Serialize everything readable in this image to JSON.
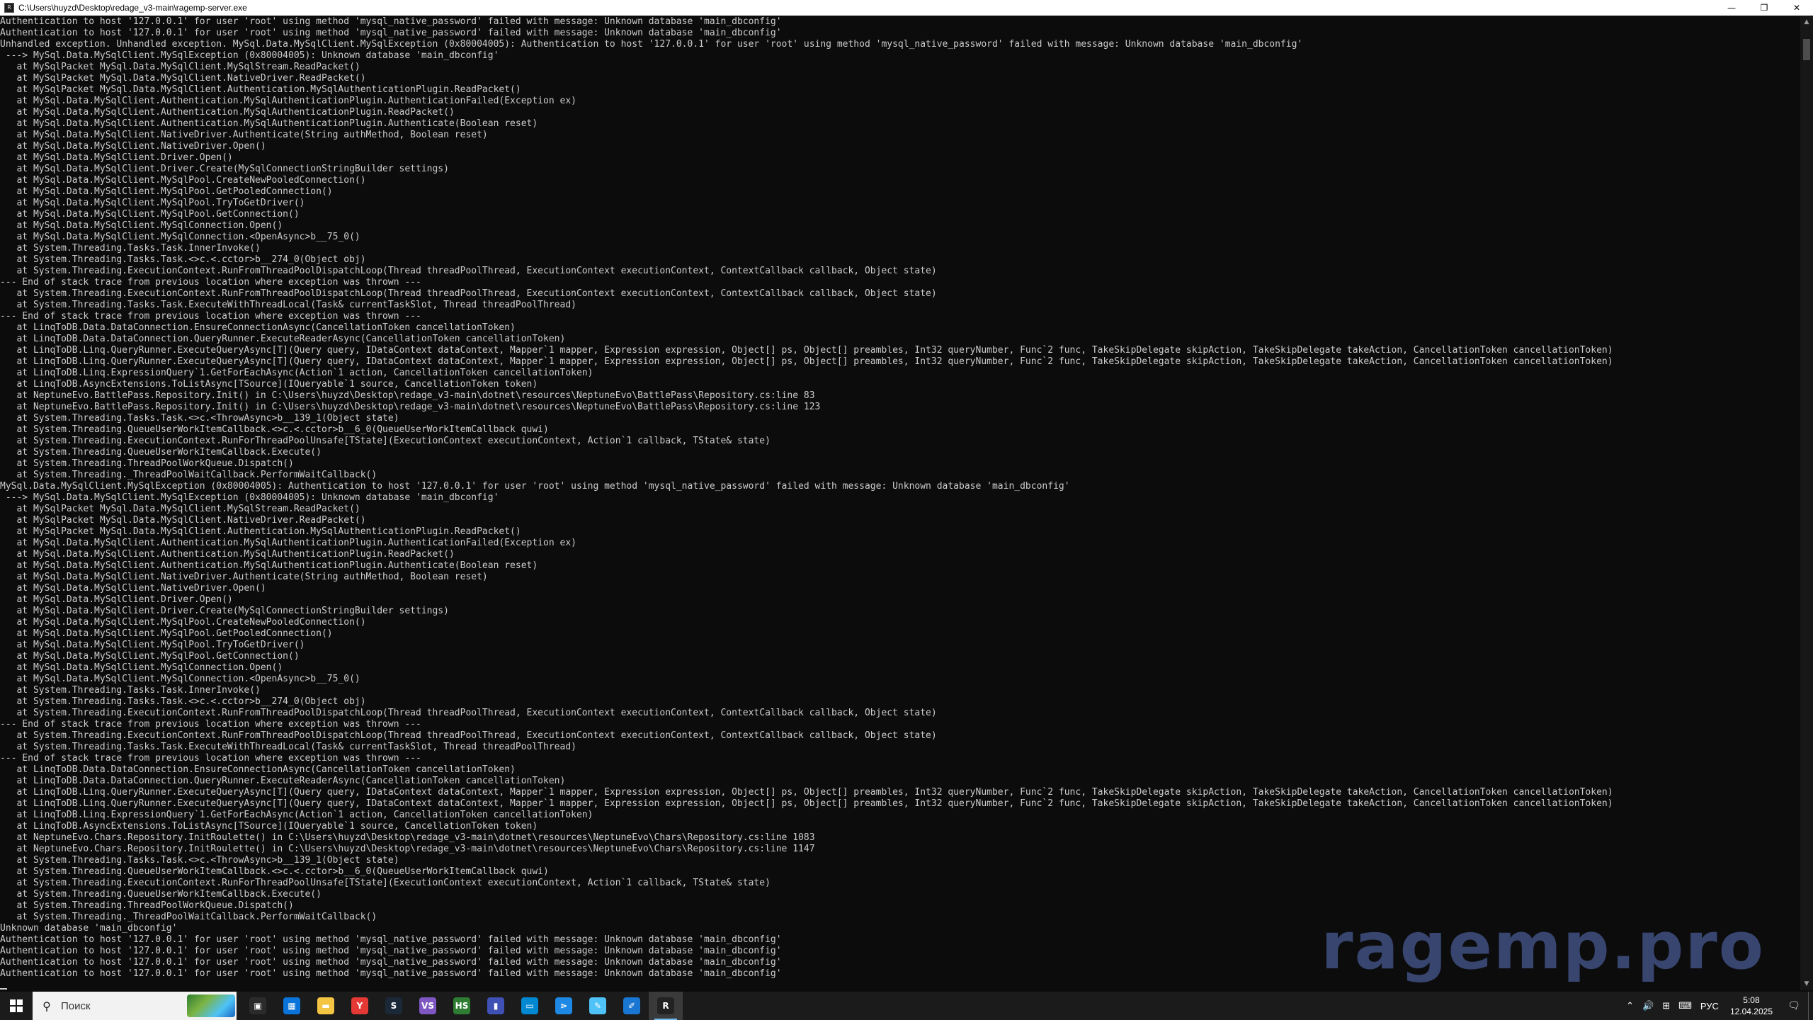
{
  "window": {
    "title": "C:\\Users\\huyzd\\Desktop\\redage_v3-main\\ragemp-server.exe",
    "icon_glyph": "R",
    "minimize_glyph": "—",
    "maximize_glyph": "❐",
    "close_glyph": "✕"
  },
  "console": {
    "lines": [
      "Authentication to host '127.0.0.1' for user 'root' using method 'mysql_native_password' failed with message: Unknown database 'main_dbconfig'",
      "Authentication to host '127.0.0.1' for user 'root' using method 'mysql_native_password' failed with message: Unknown database 'main_dbconfig'",
      "Unhandled exception. Unhandled exception. MySql.Data.MySqlClient.MySqlException (0x80004005): Authentication to host '127.0.0.1' for user 'root' using method 'mysql_native_password' failed with message: Unknown database 'main_dbconfig'",
      " ---> MySql.Data.MySqlClient.MySqlException (0x80004005): Unknown database 'main_dbconfig'",
      "   at MySqlPacket MySql.Data.MySqlClient.MySqlStream.ReadPacket()",
      "   at MySqlPacket MySql.Data.MySqlClient.NativeDriver.ReadPacket()",
      "   at MySqlPacket MySql.Data.MySqlClient.Authentication.MySqlAuthenticationPlugin.ReadPacket()",
      "   at MySql.Data.MySqlClient.Authentication.MySqlAuthenticationPlugin.AuthenticationFailed(Exception ex)",
      "   at MySql.Data.MySqlClient.Authentication.MySqlAuthenticationPlugin.ReadPacket()",
      "   at MySql.Data.MySqlClient.Authentication.MySqlAuthenticationPlugin.Authenticate(Boolean reset)",
      "   at MySql.Data.MySqlClient.NativeDriver.Authenticate(String authMethod, Boolean reset)",
      "   at MySql.Data.MySqlClient.NativeDriver.Open()",
      "   at MySql.Data.MySqlClient.Driver.Open()",
      "   at MySql.Data.MySqlClient.Driver.Create(MySqlConnectionStringBuilder settings)",
      "   at MySql.Data.MySqlClient.MySqlPool.CreateNewPooledConnection()",
      "   at MySql.Data.MySqlClient.MySqlPool.GetPooledConnection()",
      "   at MySql.Data.MySqlClient.MySqlPool.TryToGetDriver()",
      "   at MySql.Data.MySqlClient.MySqlPool.GetConnection()",
      "   at MySql.Data.MySqlClient.MySqlConnection.Open()",
      "   at MySql.Data.MySqlClient.MySqlConnection.<OpenAsync>b__75_0()",
      "   at System.Threading.Tasks.Task.InnerInvoke()",
      "   at System.Threading.Tasks.Task.<>c.<.cctor>b__274_0(Object obj)",
      "   at System.Threading.ExecutionContext.RunFromThreadPoolDispatchLoop(Thread threadPoolThread, ExecutionContext executionContext, ContextCallback callback, Object state)",
      "--- End of stack trace from previous location where exception was thrown ---",
      "   at System.Threading.ExecutionContext.RunFromThreadPoolDispatchLoop(Thread threadPoolThread, ExecutionContext executionContext, ContextCallback callback, Object state)",
      "   at System.Threading.Tasks.Task.ExecuteWithThreadLocal(Task& currentTaskSlot, Thread threadPoolThread)",
      "--- End of stack trace from previous location where exception was thrown ---",
      "   at LinqToDB.Data.DataConnection.EnsureConnectionAsync(CancellationToken cancellationToken)",
      "   at LinqToDB.Data.DataConnection.QueryRunner.ExecuteReaderAsync(CancellationToken cancellationToken)",
      "   at LinqToDB.Linq.QueryRunner.ExecuteQueryAsync[T](Query query, IDataContext dataContext, Mapper`1 mapper, Expression expression, Object[] ps, Object[] preambles, Int32 queryNumber, Func`2 func, TakeSkipDelegate skipAction, TakeSkipDelegate takeAction, CancellationToken cancellationToken)",
      "   at LinqToDB.Linq.QueryRunner.ExecuteQueryAsync[T](Query query, IDataContext dataContext, Mapper`1 mapper, Expression expression, Object[] ps, Object[] preambles, Int32 queryNumber, Func`2 func, TakeSkipDelegate skipAction, TakeSkipDelegate takeAction, CancellationToken cancellationToken)",
      "   at LinqToDB.Linq.ExpressionQuery`1.GetForEachAsync(Action`1 action, CancellationToken cancellationToken)",
      "   at LinqToDB.AsyncExtensions.ToListAsync[TSource](IQueryable`1 source, CancellationToken token)",
      "   at NeptuneEvo.BattlePass.Repository.Init() in C:\\Users\\huyzd\\Desktop\\redage_v3-main\\dotnet\\resources\\NeptuneEvo\\BattlePass\\Repository.cs:line 83",
      "   at NeptuneEvo.BattlePass.Repository.Init() in C:\\Users\\huyzd\\Desktop\\redage_v3-main\\dotnet\\resources\\NeptuneEvo\\BattlePass\\Repository.cs:line 123",
      "   at System.Threading.Tasks.Task.<>c.<ThrowAsync>b__139_1(Object state)",
      "   at System.Threading.QueueUserWorkItemCallback.<>c.<.cctor>b__6_0(QueueUserWorkItemCallback quwi)",
      "   at System.Threading.ExecutionContext.RunForThreadPoolUnsafe[TState](ExecutionContext executionContext, Action`1 callback, TState& state)",
      "   at System.Threading.QueueUserWorkItemCallback.Execute()",
      "   at System.Threading.ThreadPoolWorkQueue.Dispatch()",
      "   at System.Threading._ThreadPoolWaitCallback.PerformWaitCallback()",
      "MySql.Data.MySqlClient.MySqlException (0x80004005): Authentication to host '127.0.0.1' for user 'root' using method 'mysql_native_password' failed with message: Unknown database 'main_dbconfig'",
      " ---> MySql.Data.MySqlClient.MySqlException (0x80004005): Unknown database 'main_dbconfig'",
      "   at MySqlPacket MySql.Data.MySqlClient.MySqlStream.ReadPacket()",
      "   at MySqlPacket MySql.Data.MySqlClient.NativeDriver.ReadPacket()",
      "   at MySqlPacket MySql.Data.MySqlClient.Authentication.MySqlAuthenticationPlugin.ReadPacket()",
      "   at MySql.Data.MySqlClient.Authentication.MySqlAuthenticationPlugin.AuthenticationFailed(Exception ex)",
      "   at MySql.Data.MySqlClient.Authentication.MySqlAuthenticationPlugin.ReadPacket()",
      "   at MySql.Data.MySqlClient.Authentication.MySqlAuthenticationPlugin.Authenticate(Boolean reset)",
      "   at MySql.Data.MySqlClient.NativeDriver.Authenticate(String authMethod, Boolean reset)",
      "   at MySql.Data.MySqlClient.NativeDriver.Open()",
      "   at MySql.Data.MySqlClient.Driver.Open()",
      "   at MySql.Data.MySqlClient.Driver.Create(MySqlConnectionStringBuilder settings)",
      "   at MySql.Data.MySqlClient.MySqlPool.CreateNewPooledConnection()",
      "   at MySql.Data.MySqlClient.MySqlPool.GetPooledConnection()",
      "   at MySql.Data.MySqlClient.MySqlPool.TryToGetDriver()",
      "   at MySql.Data.MySqlClient.MySqlPool.GetConnection()",
      "   at MySql.Data.MySqlClient.MySqlConnection.Open()",
      "   at MySql.Data.MySqlClient.MySqlConnection.<OpenAsync>b__75_0()",
      "   at System.Threading.Tasks.Task.InnerInvoke()",
      "   at System.Threading.Tasks.Task.<>c.<.cctor>b__274_0(Object obj)",
      "   at System.Threading.ExecutionContext.RunFromThreadPoolDispatchLoop(Thread threadPoolThread, ExecutionContext executionContext, ContextCallback callback, Object state)",
      "--- End of stack trace from previous location where exception was thrown ---",
      "   at System.Threading.ExecutionContext.RunFromThreadPoolDispatchLoop(Thread threadPoolThread, ExecutionContext executionContext, ContextCallback callback, Object state)",
      "   at System.Threading.Tasks.Task.ExecuteWithThreadLocal(Task& currentTaskSlot, Thread threadPoolThread)",
      "--- End of stack trace from previous location where exception was thrown ---",
      "   at LinqToDB.Data.DataConnection.EnsureConnectionAsync(CancellationToken cancellationToken)",
      "   at LinqToDB.Data.DataConnection.QueryRunner.ExecuteReaderAsync(CancellationToken cancellationToken)",
      "   at LinqToDB.Linq.QueryRunner.ExecuteQueryAsync[T](Query query, IDataContext dataContext, Mapper`1 mapper, Expression expression, Object[] ps, Object[] preambles, Int32 queryNumber, Func`2 func, TakeSkipDelegate skipAction, TakeSkipDelegate takeAction, CancellationToken cancellationToken)",
      "   at LinqToDB.Linq.QueryRunner.ExecuteQueryAsync[T](Query query, IDataContext dataContext, Mapper`1 mapper, Expression expression, Object[] ps, Object[] preambles, Int32 queryNumber, Func`2 func, TakeSkipDelegate skipAction, TakeSkipDelegate takeAction, CancellationToken cancellationToken)",
      "   at LinqToDB.Linq.ExpressionQuery`1.GetForEachAsync(Action`1 action, CancellationToken cancellationToken)",
      "   at LinqToDB.AsyncExtensions.ToListAsync[TSource](IQueryable`1 source, CancellationToken token)",
      "   at NeptuneEvo.Chars.Repository.InitRoulette() in C:\\Users\\huyzd\\Desktop\\redage_v3-main\\dotnet\\resources\\NeptuneEvo\\Chars\\Repository.cs:line 1083",
      "   at NeptuneEvo.Chars.Repository.InitRoulette() in C:\\Users\\huyzd\\Desktop\\redage_v3-main\\dotnet\\resources\\NeptuneEvo\\Chars\\Repository.cs:line 1147",
      "   at System.Threading.Tasks.Task.<>c.<ThrowAsync>b__139_1(Object state)",
      "   at System.Threading.QueueUserWorkItemCallback.<>c.<.cctor>b__6_0(QueueUserWorkItemCallback quwi)",
      "   at System.Threading.ExecutionContext.RunForThreadPoolUnsafe[TState](ExecutionContext executionContext, Action`1 callback, TState& state)",
      "   at System.Threading.QueueUserWorkItemCallback.Execute()",
      "   at System.Threading.ThreadPoolWorkQueue.Dispatch()",
      "   at System.Threading._ThreadPoolWaitCallback.PerformWaitCallback()",
      "Unknown database 'main_dbconfig'",
      "Authentication to host '127.0.0.1' for user 'root' using method 'mysql_native_password' failed with message: Unknown database 'main_dbconfig'",
      "Authentication to host '127.0.0.1' for user 'root' using method 'mysql_native_password' failed with message: Unknown database 'main_dbconfig'",
      "Authentication to host '127.0.0.1' for user 'root' using method 'mysql_native_password' failed with message: Unknown database 'main_dbconfig'",
      "Authentication to host '127.0.0.1' for user 'root' using method 'mysql_native_password' failed with message: Unknown database 'main_dbconfig'"
    ]
  },
  "watermark": "ragemp.pro",
  "taskbar": {
    "search_placeholder": "Поиск",
    "apps": [
      {
        "name": "task-view",
        "glyph": "▣",
        "color": "#2b2b2b"
      },
      {
        "name": "microsoft-store",
        "glyph": "▦",
        "color": "#0a74da"
      },
      {
        "name": "file-explorer",
        "glyph": "▬",
        "color": "#f4c542"
      },
      {
        "name": "yandex-browser",
        "glyph": "Y",
        "color": "#e53935"
      },
      {
        "name": "steam",
        "glyph": "S",
        "color": "#1b2838"
      },
      {
        "name": "visual-studio",
        "glyph": "VS",
        "color": "#7e57c2"
      },
      {
        "name": "hs-app",
        "glyph": "HS",
        "color": "#2e7d32"
      },
      {
        "name": "chart-app",
        "glyph": "▮",
        "color": "#3f51b5"
      },
      {
        "name": "remote-desktop",
        "glyph": "▭",
        "color": "#0288d1"
      },
      {
        "name": "power-automate",
        "glyph": "⋗",
        "color": "#1e88e5"
      },
      {
        "name": "notepad-app",
        "glyph": "✎",
        "color": "#4fc3f7"
      },
      {
        "name": "paint-app",
        "glyph": "✐",
        "color": "#1976d2"
      },
      {
        "name": "ragemp-server",
        "glyph": "R",
        "color": "#222222",
        "active": true
      }
    ],
    "tray": {
      "chevron": "⌃",
      "volume": "🔊",
      "network": "⊞",
      "keyboard": "⌨",
      "language": "РУС",
      "time": "5:08",
      "date": "12.04.2025",
      "notification": "🗨"
    }
  }
}
